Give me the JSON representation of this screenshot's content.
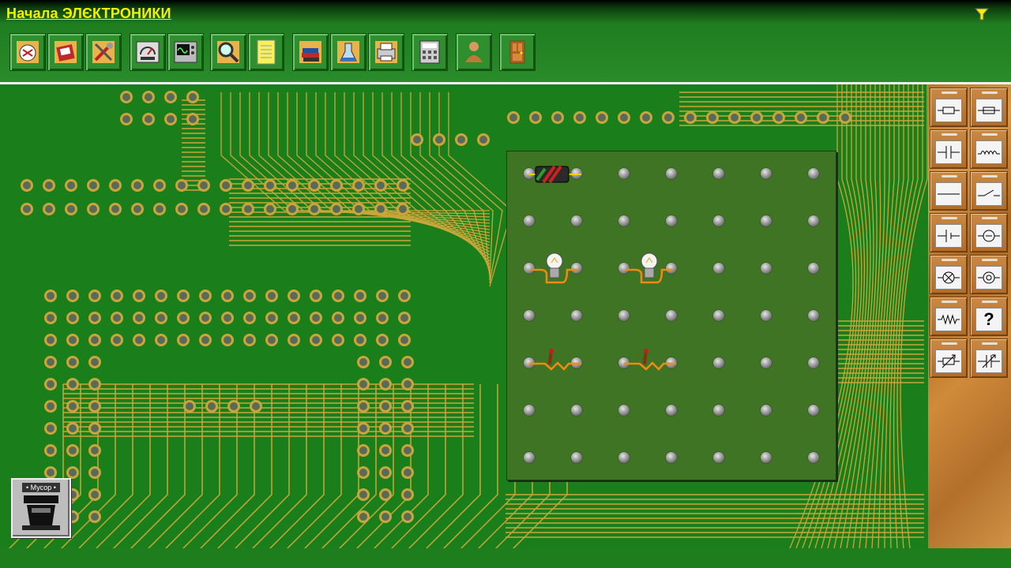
{
  "app": {
    "title": "Начала ЭЛЄКТРОНИКИ"
  },
  "toolbar": {
    "buttons": [
      {
        "name": "new-circuit",
        "icon": "new-circuit-icon"
      },
      {
        "name": "open",
        "icon": "open-icon"
      },
      {
        "name": "tools",
        "icon": "tools-icon"
      },
      {
        "name": "meter",
        "icon": "meter-icon"
      },
      {
        "name": "oscilloscope",
        "icon": "oscilloscope-icon"
      },
      {
        "name": "inspect",
        "icon": "magnifier-icon"
      },
      {
        "name": "notes",
        "icon": "notes-icon"
      },
      {
        "name": "library",
        "icon": "books-icon"
      },
      {
        "name": "experiment",
        "icon": "lab-icon"
      },
      {
        "name": "print",
        "icon": "printer-icon"
      },
      {
        "name": "calculator",
        "icon": "calculator-icon"
      },
      {
        "name": "help",
        "icon": "help-icon"
      },
      {
        "name": "exit",
        "icon": "exit-door-icon"
      }
    ]
  },
  "palette": {
    "items": [
      "fuse",
      "fuse-long",
      "capacitor",
      "inductor",
      "wire",
      "switch",
      "battery",
      "voltmeter",
      "lamp",
      "ammeter",
      "resistor",
      "unknown",
      "rheostat",
      "variable-capacitor"
    ],
    "unknown_label": "?"
  },
  "trash": {
    "label": "• Мусор •"
  },
  "colors": {
    "header": "#2a8c2a",
    "title": "#f4f000",
    "board": "#3e7424",
    "pcb": "#1a7f1a"
  }
}
